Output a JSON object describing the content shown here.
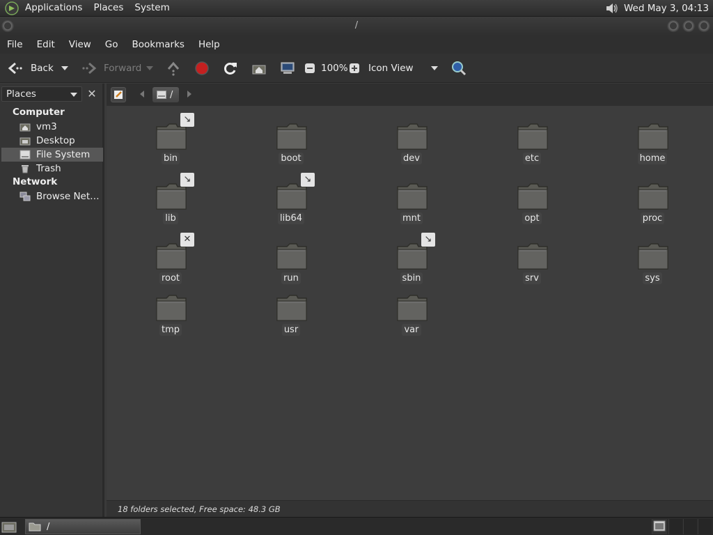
{
  "top_panel": {
    "menus": [
      "Applications",
      "Places",
      "System"
    ],
    "clock": "Wed May  3, 04:13"
  },
  "window": {
    "title": "/"
  },
  "menubar": [
    "File",
    "Edit",
    "View",
    "Go",
    "Bookmarks",
    "Help"
  ],
  "toolbar": {
    "back": "Back",
    "forward": "Forward",
    "zoom": "100%",
    "view_mode": "Icon View"
  },
  "sidebar": {
    "header": "Places",
    "computer_label": "Computer",
    "computer_items": [
      "vm3",
      "Desktop",
      "File System",
      "Trash"
    ],
    "network_label": "Network",
    "network_items": [
      "Browse Net…"
    ]
  },
  "location": {
    "path": "/"
  },
  "folders": [
    {
      "name": "bin",
      "emblem": "↘"
    },
    {
      "name": "boot",
      "emblem": ""
    },
    {
      "name": "dev",
      "emblem": ""
    },
    {
      "name": "etc",
      "emblem": ""
    },
    {
      "name": "home",
      "emblem": ""
    },
    {
      "name": "lib",
      "emblem": "↘"
    },
    {
      "name": "lib64",
      "emblem": "↘"
    },
    {
      "name": "mnt",
      "emblem": ""
    },
    {
      "name": "opt",
      "emblem": ""
    },
    {
      "name": "proc",
      "emblem": ""
    },
    {
      "name": "root",
      "emblem": "✕"
    },
    {
      "name": "run",
      "emblem": ""
    },
    {
      "name": "sbin",
      "emblem": "↘"
    },
    {
      "name": "srv",
      "emblem": ""
    },
    {
      "name": "sys",
      "emblem": ""
    },
    {
      "name": "tmp",
      "emblem": ""
    },
    {
      "name": "usr",
      "emblem": ""
    },
    {
      "name": "var",
      "emblem": ""
    }
  ],
  "status": "18 folders selected, Free space: 48.3 GB",
  "taskbar": {
    "task_label": "/"
  },
  "colors": {
    "background": "#3d3d3d",
    "panel": "#2f2f2f",
    "selected": "#575757",
    "folder": "#5f5f59"
  }
}
